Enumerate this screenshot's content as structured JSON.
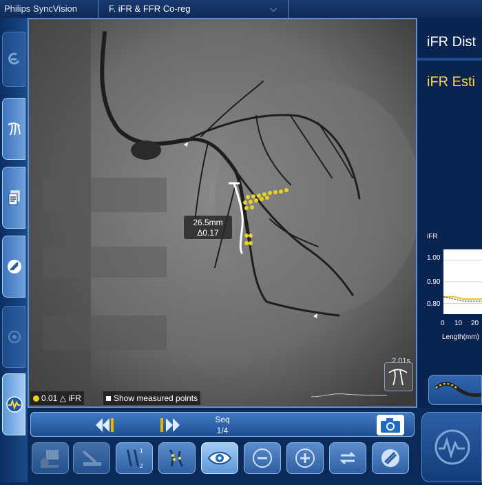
{
  "titlebar": {
    "app_name": "Philips SyncVision",
    "document_title": "F. iFR & FFR Co-reg"
  },
  "viewer": {
    "measurement_length": "26.5mm",
    "measurement_delta": "Δ0.17",
    "timestamp": "2.01s",
    "legend_ifr": "0.01 △ iFR",
    "legend_points": "Show measured points"
  },
  "right_panel": {
    "title_distance": "iFR Dist",
    "title_estimate": "iFR Esti",
    "chart_data": {
      "type": "line",
      "ylabel": "iFR",
      "xlabel": "Length(mm)",
      "y_ticks": [
        "1.00",
        "0.90",
        "0.80"
      ],
      "x_ticks": [
        "0",
        "10",
        "20"
      ],
      "ylim": [
        0.75,
        1.05
      ],
      "series": [
        {
          "values": [
            0.83,
            0.83,
            0.82,
            0.82,
            0.82
          ]
        },
        {
          "values": [
            0.83,
            0.82,
            0.81,
            0.81,
            0.81
          ]
        }
      ],
      "x": [
        0,
        5,
        10,
        15,
        20
      ]
    }
  },
  "playbar": {
    "seq_label": "Seq",
    "seq_value": "1/4"
  },
  "colors": {
    "accent": "#3f7ac2",
    "highlight": "#ffd83a",
    "marker": "#e8d323"
  }
}
